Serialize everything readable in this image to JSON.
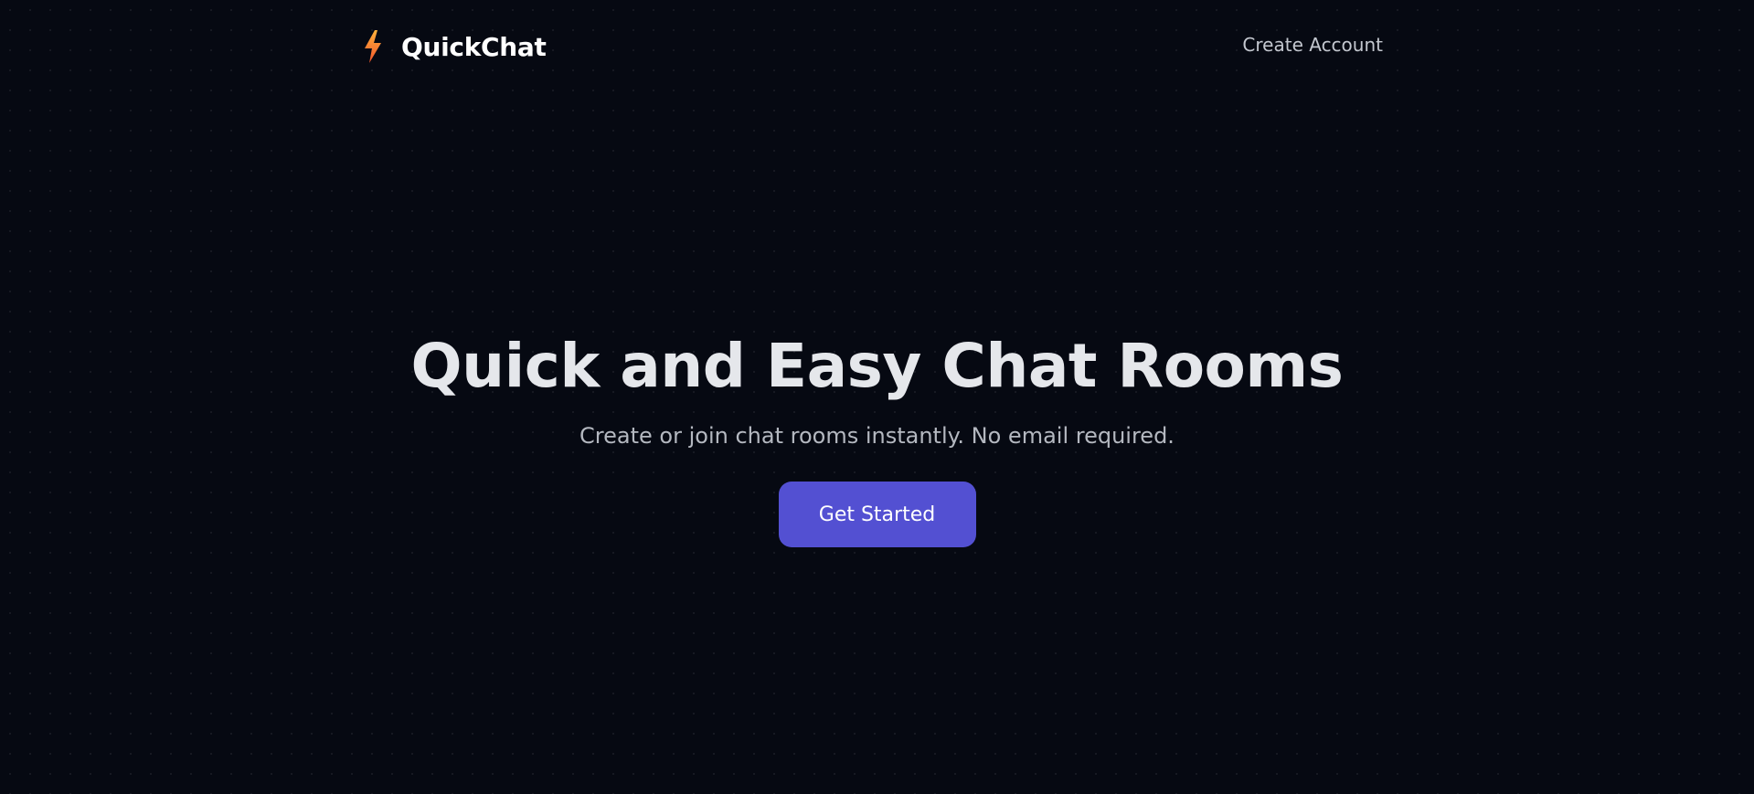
{
  "header": {
    "brand_name": "QuickChat",
    "brand_icon": "lightning-bolt-icon",
    "nav_link_label": "Create Account"
  },
  "hero": {
    "title": "Quick and Easy Chat Rooms",
    "subtitle": "Create or join chat rooms instantly. No email required.",
    "cta_label": "Get Started"
  },
  "colors": {
    "background": "#060912",
    "accent": "#5350d2",
    "bolt_top": "#ffb13b",
    "bolt_bottom": "#f2552c",
    "title_text": "#e5e7eb",
    "muted_text": "#b4b8c0"
  }
}
